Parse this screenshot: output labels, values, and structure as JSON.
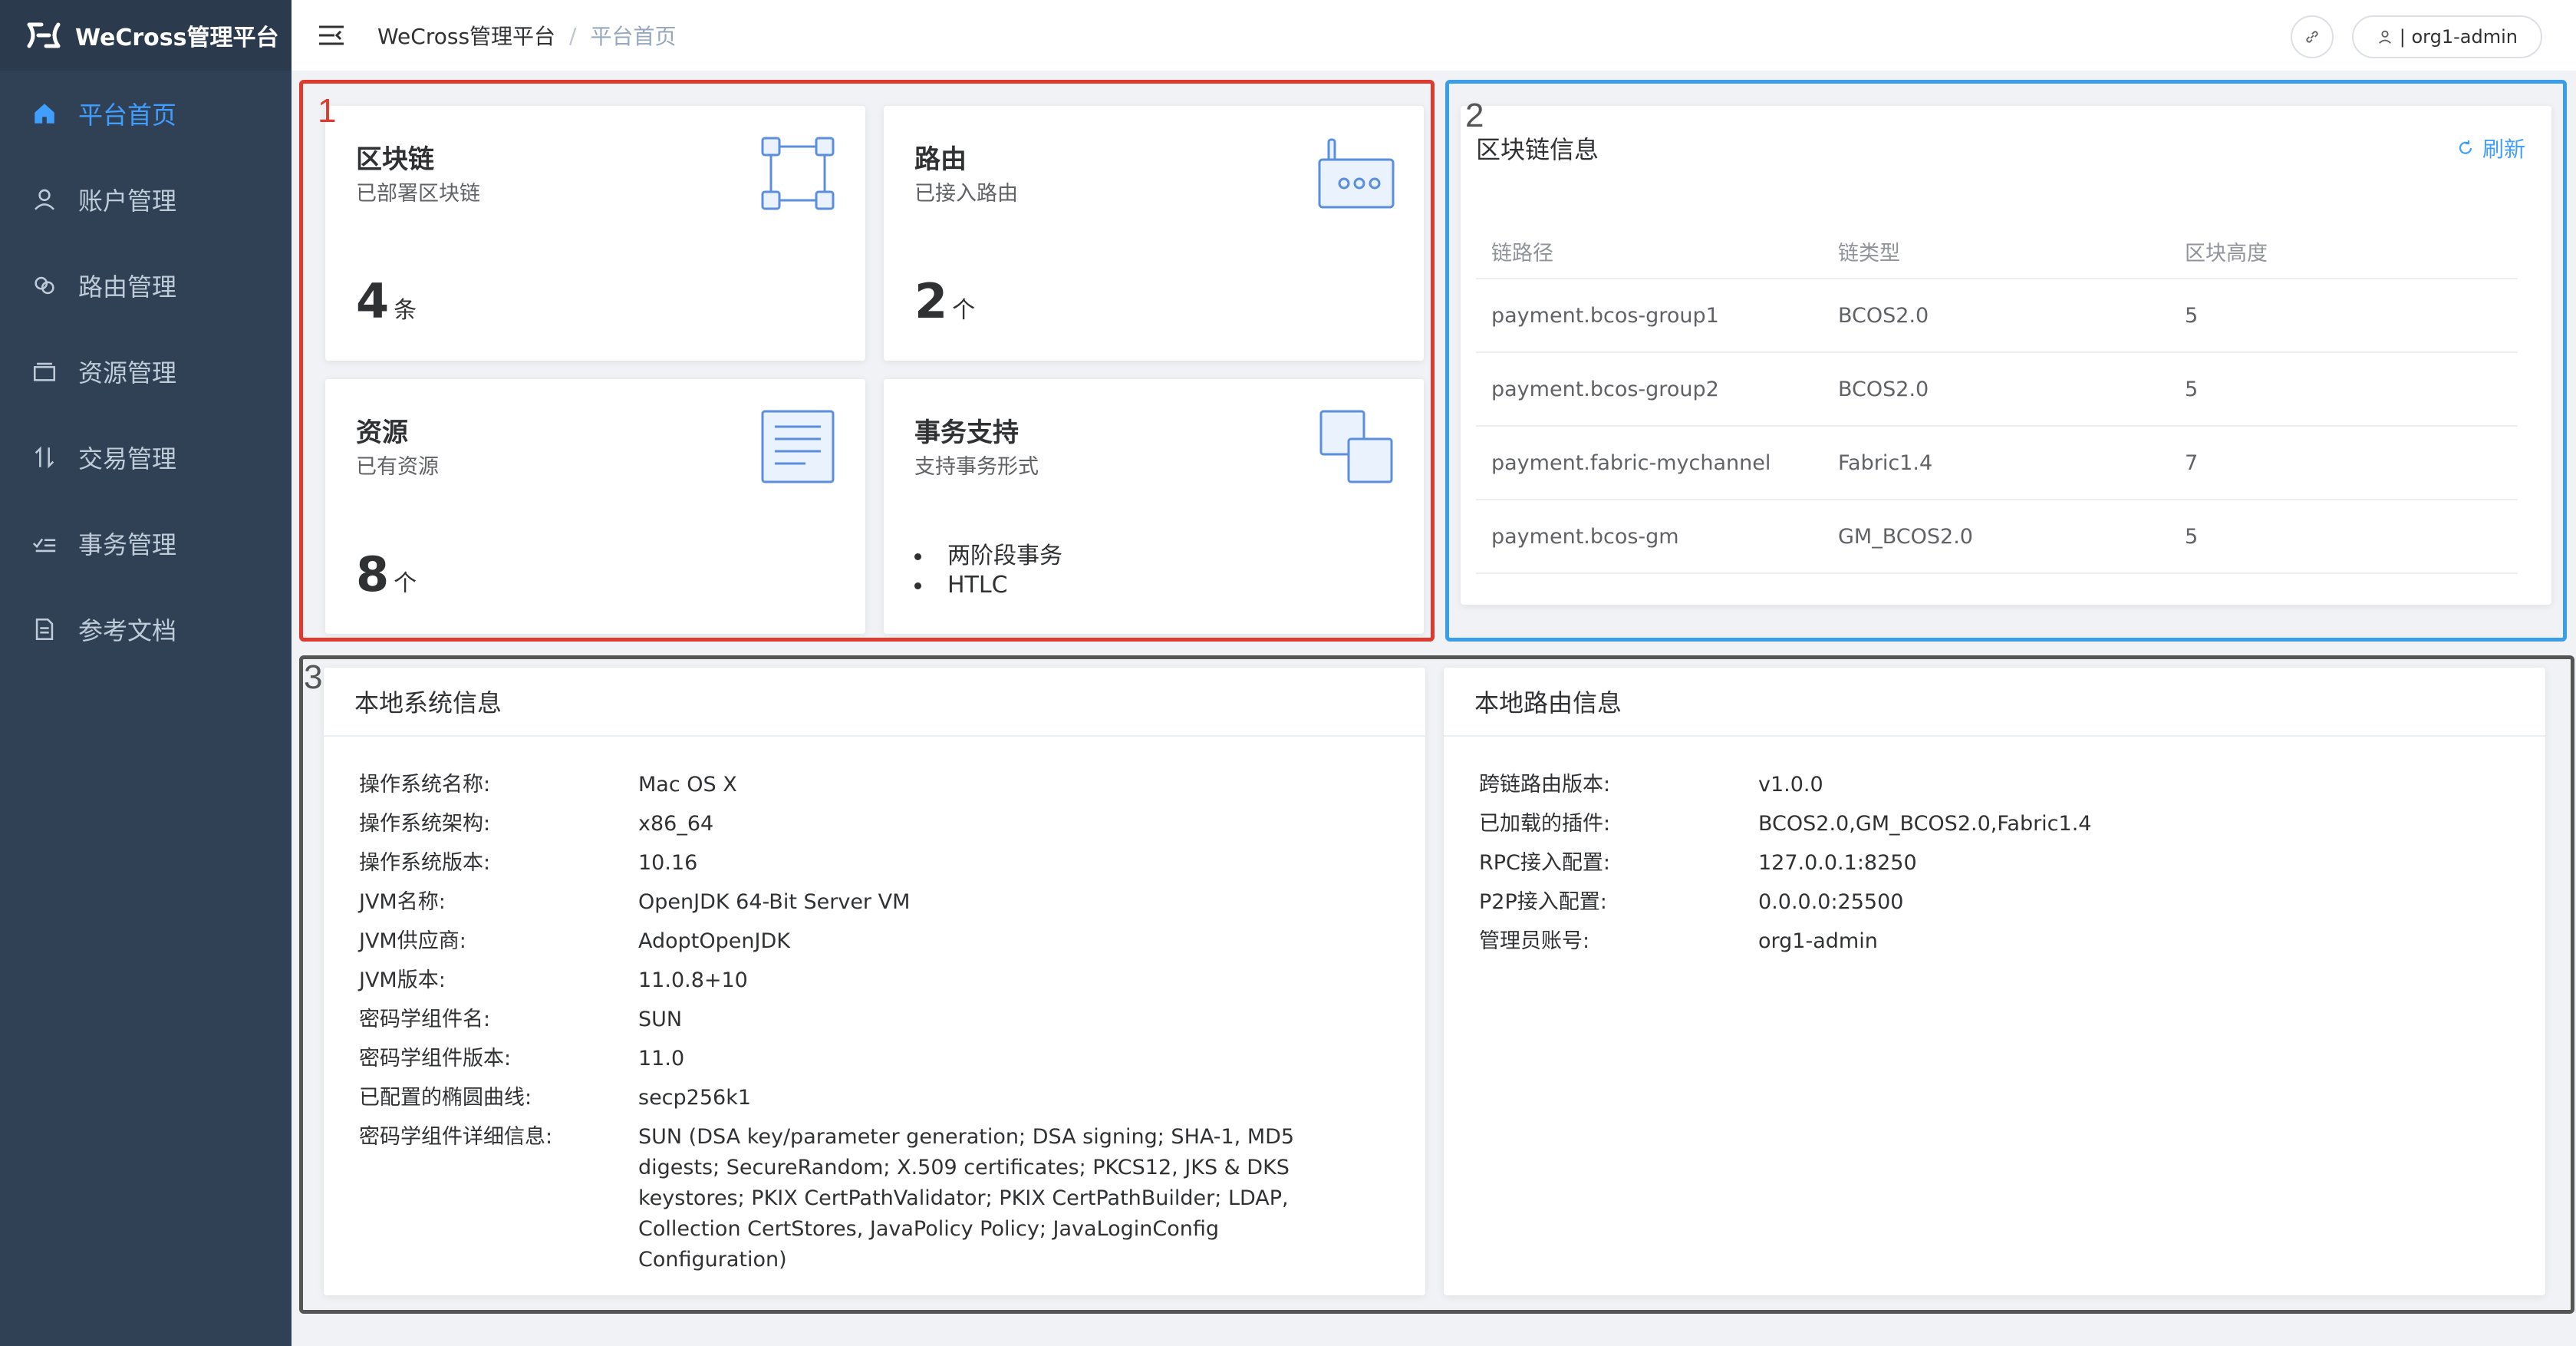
{
  "app": {
    "logo_mark": "ℸ",
    "title": "WeCross管理平台"
  },
  "sidebar": {
    "items": [
      {
        "label": "平台首页",
        "icon": "home-icon",
        "active": true
      },
      {
        "label": "账户管理",
        "icon": "user-icon"
      },
      {
        "label": "路由管理",
        "icon": "link-icon"
      },
      {
        "label": "资源管理",
        "icon": "folder-icon"
      },
      {
        "label": "交易管理",
        "icon": "transaction-icon"
      },
      {
        "label": "事务管理",
        "icon": "checklist-icon"
      },
      {
        "label": "参考文档",
        "icon": "document-icon"
      }
    ]
  },
  "header": {
    "breadcrumb": [
      "WeCross管理平台",
      "平台首页"
    ],
    "separator": "/",
    "user_label": "| org1-admin"
  },
  "annotations": {
    "box1": "1",
    "box2": "2",
    "box3": "3"
  },
  "stats": {
    "chains": {
      "title": "区块链",
      "sub": "已部署区块链",
      "value": "4",
      "unit": "条",
      "icon": "blockchain-icon"
    },
    "routers": {
      "title": "路由",
      "sub": "已接入路由",
      "value": "2",
      "unit": "个",
      "icon": "router-icon"
    },
    "resources": {
      "title": "资源",
      "sub": "已有资源",
      "value": "8",
      "unit": "个",
      "icon": "resource-doc-icon"
    },
    "transactions": {
      "title": "事务支持",
      "sub": "支持事务形式",
      "items": [
        "两阶段事务",
        "HTLC"
      ],
      "icon": "overlap-squares-icon"
    }
  },
  "chain_info": {
    "title": "区块链信息",
    "refresh": "刷新",
    "columns": [
      "链路径",
      "链类型",
      "区块高度"
    ],
    "rows": [
      [
        "payment.bcos-group1",
        "BCOS2.0",
        "5"
      ],
      [
        "payment.bcos-group2",
        "BCOS2.0",
        "5"
      ],
      [
        "payment.fabric-mychannel",
        "Fabric1.4",
        "7"
      ],
      [
        "payment.bcos-gm",
        "GM_BCOS2.0",
        "5"
      ]
    ]
  },
  "system_info": {
    "title": "本地系统信息",
    "rows": [
      [
        "操作系统名称:",
        "Mac OS X"
      ],
      [
        "操作系统架构:",
        "x86_64"
      ],
      [
        "操作系统版本:",
        "10.16"
      ],
      [
        "JVM名称:",
        "OpenJDK 64-Bit Server VM"
      ],
      [
        "JVM供应商:",
        "AdoptOpenJDK"
      ],
      [
        "JVM版本:",
        "11.0.8+10"
      ],
      [
        "密码学组件名:",
        "SUN"
      ],
      [
        "密码学组件版本:",
        "11.0"
      ],
      [
        "已配置的椭圆曲线:",
        "secp256k1"
      ],
      [
        "密码学组件详细信息:",
        "SUN (DSA key/parameter generation; DSA signing; SHA-1, MD5 digests; SecureRandom; X.509 certificates; PKCS12, JKS & DKS keystores; PKIX CertPathValidator; PKIX CertPathBuilder; LDAP, Collection CertStores, JavaPolicy Policy; JavaLoginConfig Configuration)"
      ]
    ]
  },
  "router_info": {
    "title": "本地路由信息",
    "rows": [
      [
        "跨链路由版本:",
        "v1.0.0"
      ],
      [
        "已加载的插件:",
        "BCOS2.0,GM_BCOS2.0,Fabric1.4"
      ],
      [
        "RPC接入配置:",
        "127.0.0.1:8250"
      ],
      [
        "P2P接入配置:",
        "0.0.0.0:25500"
      ],
      [
        "管理员账号:",
        "org1-admin"
      ]
    ]
  },
  "colors": {
    "sidebar_bg": "#304156",
    "active": "#409eff",
    "box1": "#e03a2e",
    "box2": "#3a9ee8",
    "box3": "#555555"
  }
}
